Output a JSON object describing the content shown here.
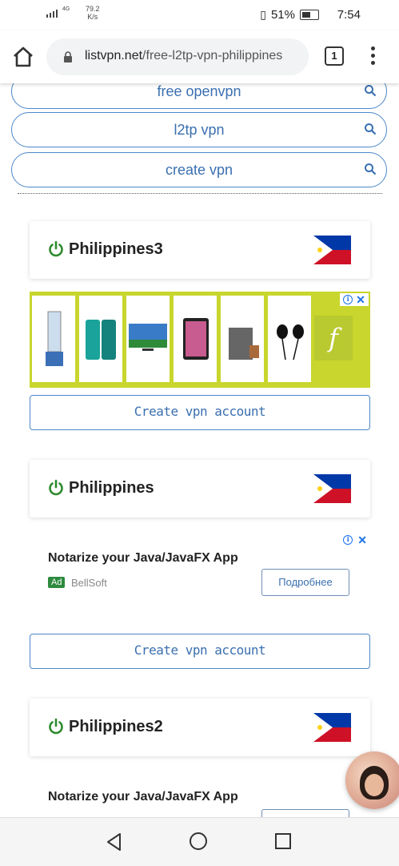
{
  "status_bar": {
    "network": "4G",
    "speed": "79.2",
    "speed_unit": "K/s",
    "battery_pct": "51%",
    "time": "7:54"
  },
  "browser": {
    "url_host": "listvpn.net",
    "url_path": "/free-l2tp-vpn-philippines",
    "tab_count": "1"
  },
  "search_pills": [
    {
      "label": "free openvpn"
    },
    {
      "label": "l2tp vpn"
    },
    {
      "label": "create vpn"
    }
  ],
  "servers": [
    {
      "name": "Philippines3",
      "create_label": "Create vpn account"
    },
    {
      "name": "Philippines",
      "create_label": "Create vpn account"
    },
    {
      "name": "Philippines2"
    }
  ],
  "ad_products": {
    "logo_letter": "f"
  },
  "text_ads": [
    {
      "headline": "Notarize your Java/JavaFX App",
      "badge": "Ad",
      "advertiser": "BellSoft",
      "button": "Подробнее"
    },
    {
      "headline": "Notarize your Java/JavaFX App"
    }
  ],
  "colors": {
    "accent": "#4c87c9",
    "power_green": "#2e8b2e",
    "ad_bg": "#c8d62d"
  }
}
